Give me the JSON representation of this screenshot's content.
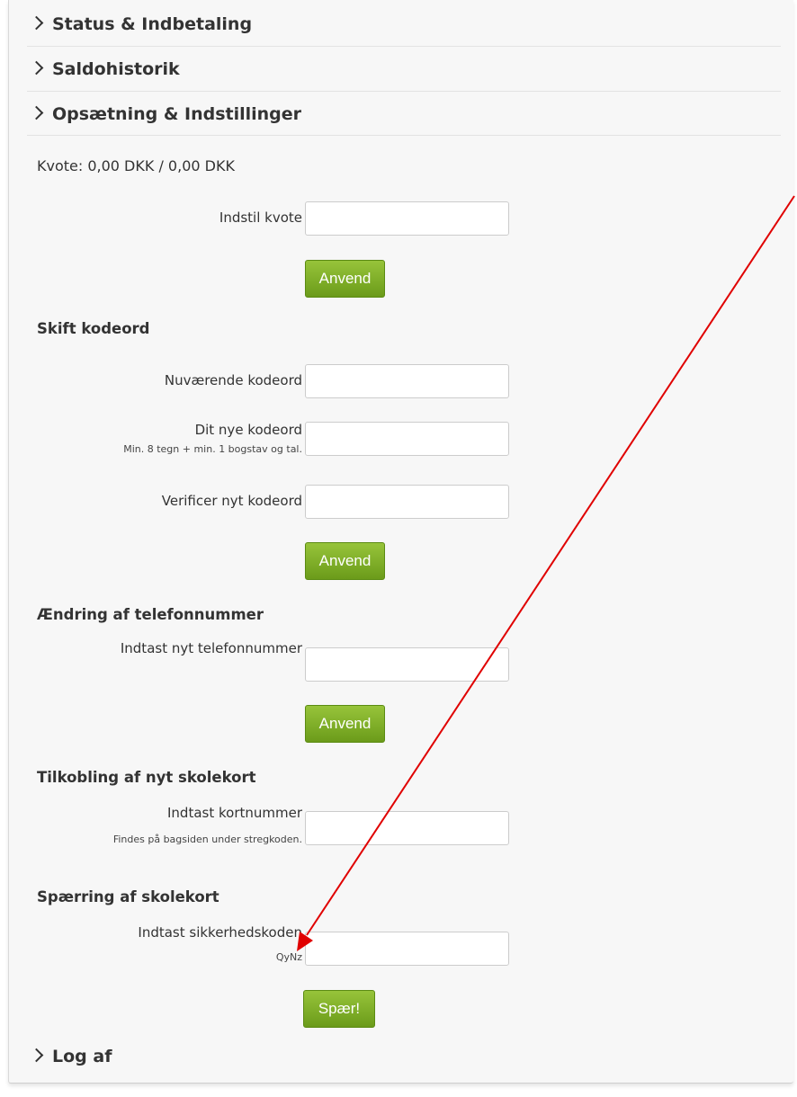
{
  "nav": {
    "status": "Status & Indbetaling",
    "saldo": "Saldohistorik",
    "setup": "Opsætning & Indstillinger",
    "logout": "Log af"
  },
  "quota": {
    "title": "Kvote: 0,00 DKK / 0,00 DKK",
    "label": "Indstil kvote",
    "button": "Anvend"
  },
  "password": {
    "title": "Skift kodeord",
    "current_label": "Nuværende kodeord",
    "new_label": "Dit nye kodeord",
    "new_hint": "Min. 8 tegn + min. 1 bogstav og tal.",
    "verify_label": "Verificer nyt kodeord",
    "button": "Anvend"
  },
  "phone": {
    "title": "Ændring af telefonnummer",
    "label": "Indtast nyt telefonnummer",
    "button": "Anvend"
  },
  "card": {
    "title": "Tilkobling af nyt skolekort",
    "label": "Indtast kortnummer",
    "hint": "Findes på bagsiden under stregkoden."
  },
  "block": {
    "title": "Spærring af skolekort",
    "label": "Indtast sikkerhedskoden",
    "code": "QyNz",
    "button": "Spær!"
  },
  "colors": {
    "button_green": "#7fb12a",
    "annotation_arrow": "#e00000"
  }
}
